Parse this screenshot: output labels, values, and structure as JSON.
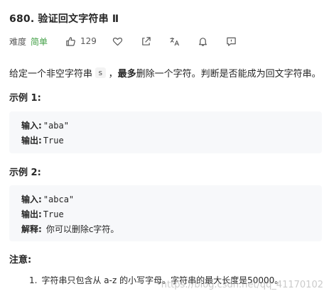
{
  "problem": {
    "title": "680. 验证回文字符串 Ⅱ",
    "difficulty_label": "难度",
    "difficulty": "简单",
    "likes": "129"
  },
  "description": {
    "prefix": "给定一个非空字符串",
    "var": "s",
    "sep": "，",
    "emphasis": "最多",
    "suffix": "删除一个字符。判断是否能成为回文字符串。"
  },
  "examples": [
    {
      "title": "示例 1:",
      "input_label": "输入:",
      "input_value": "\"aba\"",
      "output_label": "输出:",
      "output_value": "True"
    },
    {
      "title": "示例 2:",
      "input_label": "输入:",
      "input_value": "\"abca\"",
      "output_label": "输出:",
      "output_value": "True",
      "explain_label": "解释:",
      "explain_value": "你可以删除c字符。"
    }
  ],
  "note": {
    "title": "注意:",
    "items": [
      {
        "num": "1.",
        "text": "字符串只包含从 a-z 的小写字母。字符串的最大长度是50000。"
      }
    ]
  },
  "watermark": "https://blog.csdn.net/qq_41170102",
  "icons": {
    "like": "thumbs-up-icon",
    "favorite": "heart-icon",
    "share": "share-icon",
    "translate": "translate-icon",
    "notify": "bell-icon",
    "feedback": "feedback-icon"
  },
  "colors": {
    "difficulty_easy": "#43a047",
    "code_bg": "#f7f8fa",
    "text": "#262626"
  }
}
